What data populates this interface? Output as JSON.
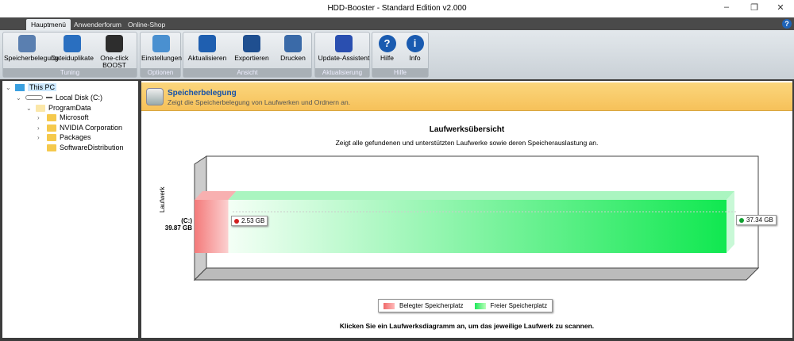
{
  "window": {
    "title": "HDD-Booster - Standard Edition v2.000",
    "minimize": "–",
    "restore": "❐",
    "close": "✕"
  },
  "tabs": [
    {
      "label": "Hauptmenü",
      "active": true
    },
    {
      "label": "Anwenderforum"
    },
    {
      "label": "Online-Shop"
    }
  ],
  "help_icon": "?",
  "ribbon": {
    "groups": [
      {
        "label": "Tuning",
        "buttons": [
          {
            "label": "Speicherbelegung",
            "icon": "disk-usage-icon",
            "color": "#5a7fb0"
          },
          {
            "label": "Dateiduplikate",
            "icon": "duplicates-icon",
            "color": "#2a6fc0"
          },
          {
            "label": "One-click BOOST",
            "icon": "boost-gauge-icon",
            "color": "#2d2d2d"
          }
        ]
      },
      {
        "label": "Optionen",
        "buttons": [
          {
            "label": "Einstellungen",
            "icon": "tools-icon",
            "color": "#4a90d0"
          }
        ]
      },
      {
        "label": "Ansicht",
        "buttons": [
          {
            "label": "Aktualisieren",
            "icon": "refresh-icon",
            "color": "#1f5fb0"
          },
          {
            "label": "Exportieren",
            "icon": "floppy-icon",
            "color": "#1f4f90"
          },
          {
            "label": "Drucken",
            "icon": "printer-icon",
            "color": "#3a6aa8"
          }
        ]
      },
      {
        "label": "Aktualisierung",
        "buttons": [
          {
            "label": "Update-Assistent",
            "icon": "wizard-icon",
            "color": "#2a4fb0"
          }
        ]
      },
      {
        "label": "Hilfe",
        "buttons": [
          {
            "label": "Hilfe",
            "icon": "help-icon",
            "color": "#1a5bb0"
          },
          {
            "label": "Info",
            "icon": "info-icon",
            "color": "#1a5bb0"
          }
        ]
      }
    ]
  },
  "tree": {
    "root": "This PC",
    "disk": "Local Disk (C:)",
    "folder": "ProgramData",
    "children": [
      "Microsoft",
      "NVIDIA Corporation",
      "Packages",
      "SoftwareDistribution"
    ]
  },
  "header": {
    "title": "Speicherbelegung",
    "subtitle": "Zeigt die Speicherbelegung von Laufwerken und Ordnern an."
  },
  "chart_data": {
    "type": "bar",
    "orientation": "horizontal",
    "stacked": true,
    "title": "Laufwerksübersicht",
    "subtitle": "Zeigt alle gefundenen und unterstützten Laufwerke sowie deren Speicherauslastung an.",
    "ylabel": "Laufwerk",
    "categories": [
      "(C:)"
    ],
    "category_totals": [
      "39.87 GB"
    ],
    "series": [
      {
        "name": "Belegter Speicherplatz",
        "values": [
          2.53
        ],
        "label": "2.53 GB",
        "color": "#f06a6a"
      },
      {
        "name": "Freier Speicherplatz",
        "values": [
          37.34
        ],
        "label": "37.34 GB",
        "color": "#1ee85a"
      }
    ],
    "legend": "bottom-center"
  },
  "footer_hint": "Klicken Sie ein Laufwerksdiagramm an, um das jeweilige Laufwerk zu scannen."
}
